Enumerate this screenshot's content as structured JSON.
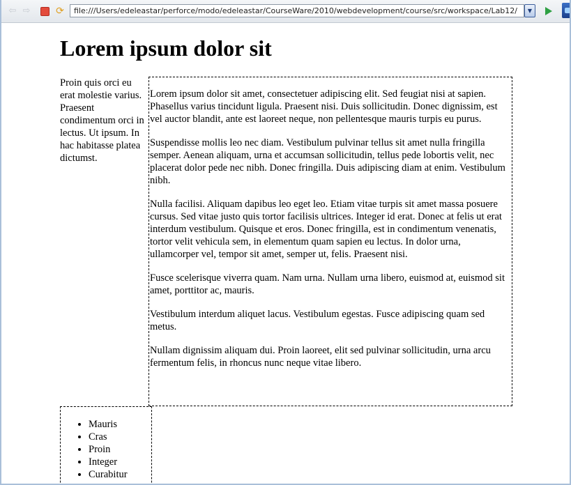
{
  "browser": {
    "url": "file:///Users/edeleastar/perforce/modo/edeleastar/CourseWare/2010/webdevelopment/course/src/workspace/Lab12/",
    "back_icon": "⇦",
    "forward_icon": "⇨",
    "refresh_icon": "⟳",
    "dropdown_icon": "▼"
  },
  "page": {
    "title": "Lorem ipsum dolor sit",
    "sidebar_text": "Proin quis orci eu erat molestie varius. Praesent condimentum orci in lectus. Ut ipsum. In hac habitasse platea dictumst.",
    "paragraphs": [
      "Lorem ipsum dolor sit amet, consectetuer adipiscing elit. Sed feugiat nisi at sapien. Phasellus varius tincidunt ligula. Praesent nisi. Duis sollicitudin. Donec dignissim, est vel auctor blandit, ante est laoreet neque, non pellentesque mauris turpis eu purus.",
      "Suspendisse mollis leo nec diam. Vestibulum pulvinar tellus sit amet nulla fringilla semper. Aenean aliquam, urna et accumsan sollicitudin, tellus pede lobortis velit, nec placerat dolor pede nec nibh. Donec fringilla. Duis adipiscing diam at enim. Vestibulum nibh.",
      "Nulla facilisi. Aliquam dapibus leo eget leo. Etiam vitae turpis sit amet massa posuere cursus. Sed vitae justo quis tortor facilisis ultrices. Integer id erat. Donec at felis ut erat interdum vestibulum. Quisque et eros. Donec fringilla, est in condimentum venenatis, tortor velit vehicula sem, in elementum quam sapien eu lectus. In dolor urna, ullamcorper vel, tempor sit amet, semper ut, felis. Praesent nisi.",
      "Fusce scelerisque viverra quam. Nam urna. Nullam urna libero, euismod at, euismod sit amet, porttitor ac, mauris.",
      "Vestibulum interdum aliquet lacus. Vestibulum egestas. Fusce adipiscing quam sed metus.",
      "Nullam dignissim aliquam dui. Proin laoreet, elit sed pulvinar sollicitudin, urna arcu fermentum felis, in rhoncus nunc neque vitae libero."
    ],
    "list_items": [
      "Mauris",
      "Cras",
      "Proin",
      "Integer",
      "Curabitur"
    ]
  }
}
